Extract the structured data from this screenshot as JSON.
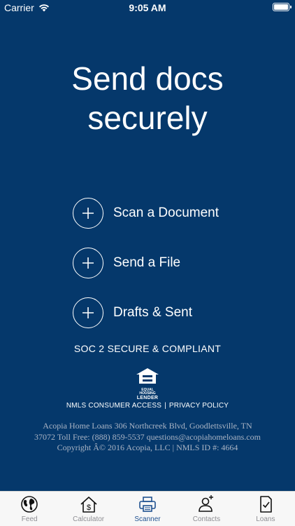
{
  "status_bar": {
    "carrier": "Carrier",
    "time": "9:05 AM"
  },
  "headline": {
    "line1": "Send docs",
    "line2": "securely"
  },
  "actions": [
    {
      "label": "Scan a Document",
      "icon": "plus-icon"
    },
    {
      "label": "Send a File",
      "icon": "plus-icon"
    },
    {
      "label": "Drafts & Sent",
      "icon": "plus-icon"
    }
  ],
  "compliance": "SOC 2 SECURE & COMPLIANT",
  "equal_housing_logo": {
    "icon": "equal-housing-lender-icon",
    "line1": "EQUAL HOUSING",
    "line2": "LENDER"
  },
  "links": {
    "nmls": "NMLS CONSUMER ACCESS",
    "separator": "|",
    "privacy": "PRIVACY POLICY"
  },
  "address": {
    "line1": "Acopia Home Loans 306 Northcreek Blvd, Goodlettsville, TN",
    "line2": "37072 Toll Free: (888) 859-5537 questions@acopiahomeloans.com",
    "line3": "Copyright Â© 2016 Acopia, LLC | NMLS ID #: 4664"
  },
  "tabs": [
    {
      "label": "Feed",
      "icon": "globe-icon",
      "active": false
    },
    {
      "label": "Calculator",
      "icon": "house-dollar-icon",
      "active": false
    },
    {
      "label": "Scanner",
      "icon": "printer-icon",
      "active": true
    },
    {
      "label": "Contacts",
      "icon": "contact-user-icon",
      "active": false
    },
    {
      "label": "Loans",
      "icon": "document-check-icon",
      "active": false
    }
  ],
  "colors": {
    "background": "#05386b",
    "tab_active": "#1f5190",
    "tab_inactive": "#8e8e93"
  }
}
